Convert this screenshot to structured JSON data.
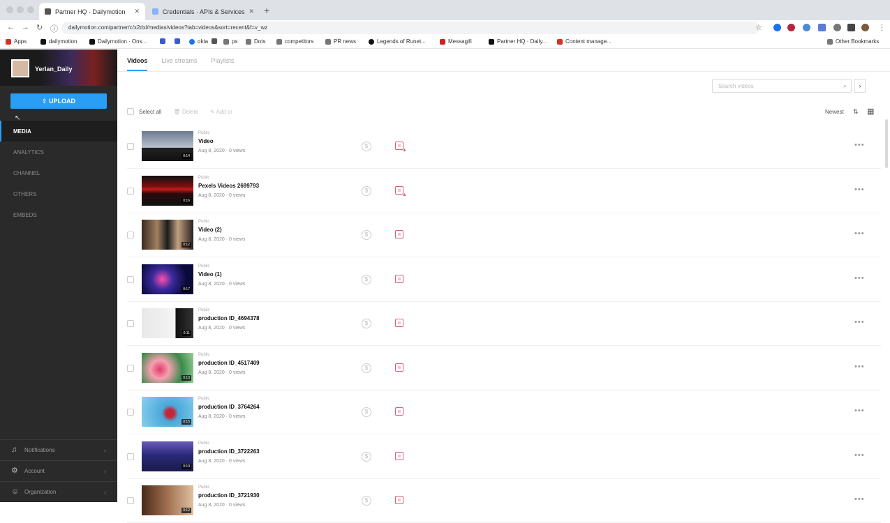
{
  "browser": {
    "tabs": [
      {
        "label": "Partner HQ · Dailymotion",
        "active": true
      },
      {
        "label": "Credentials · APIs & Services",
        "active": false
      }
    ],
    "address": "dailymotion.com/partner/c/x2dxl/medias/videos?tab=videos&sort=recent&f=v_wz",
    "bookmarks": [
      "Apps",
      "dailymotion",
      "Dailymotion · Ons...",
      "",
      "",
      "okta",
      "",
      "ps",
      "Dots",
      "competitors",
      "PR news",
      "Legends of Runet...",
      "Messagifi",
      "Partner HQ · Daily...",
      "Content manage..."
    ],
    "other_bookmarks": "Other Bookmarks"
  },
  "sidebar": {
    "username": "Yerlan_Daily",
    "upload_label": "⇪ UPLOAD",
    "nav": [
      {
        "label": "MEDIA",
        "active": true
      },
      {
        "label": "ANALYTICS",
        "active": false
      },
      {
        "label": "CHANNEL",
        "active": false
      },
      {
        "label": "OTHERS",
        "active": false
      },
      {
        "label": "EMBEDS",
        "active": false
      }
    ],
    "footer": [
      {
        "label": "Notifications",
        "icon": "bell"
      },
      {
        "label": "Account",
        "icon": "gear"
      },
      {
        "label": "Organization",
        "icon": "people"
      }
    ]
  },
  "main": {
    "tabs": [
      {
        "label": "Videos",
        "active": true
      },
      {
        "label": "Live streams",
        "active": false
      },
      {
        "label": "Playlists",
        "active": false
      }
    ],
    "search_placeholder": "Search videos",
    "toolbar": {
      "select_all": "Select all",
      "delete": "Delete",
      "edit": "Add to",
      "sort": "Newest"
    },
    "rows": [
      {
        "visibility": "Public",
        "title": "Video",
        "date": "Aug 8, 2020 · 0 views",
        "duration": "0:14",
        "warn": true,
        "thumb": "sunset"
      },
      {
        "visibility": "Public",
        "title": "Pexels Videos 2699793",
        "date": "Aug 8, 2020 · 0 views",
        "duration": "0:16",
        "warn": true,
        "thumb": "red"
      },
      {
        "visibility": "Public",
        "title": "Video (2)",
        "date": "Aug 8, 2020 · 0 views",
        "duration": "0:12",
        "warn": false,
        "thumb": "band"
      },
      {
        "visibility": "Public",
        "title": "Video (1)",
        "date": "Aug 8, 2020 · 0 views",
        "duration": "0:17",
        "warn": false,
        "thumb": "concert"
      },
      {
        "visibility": "Public",
        "title": "production ID_4694378",
        "date": "Aug 8, 2020 · 0 views",
        "duration": "0:11",
        "warn": false,
        "thumb": "text"
      },
      {
        "visibility": "Public",
        "title": "production ID_4517409",
        "date": "Aug 8, 2020 · 0 views",
        "duration": "0:13",
        "warn": false,
        "thumb": "flowers"
      },
      {
        "visibility": "Public",
        "title": "production ID_3764264",
        "date": "Aug 8, 2020 · 0 views",
        "duration": "0:15",
        "warn": false,
        "thumb": "sea"
      },
      {
        "visibility": "Public",
        "title": "production ID_3722263",
        "date": "Aug 8, 2020 · 0 views",
        "duration": "0:10",
        "warn": false,
        "thumb": "crowd"
      },
      {
        "visibility": "Public",
        "title": "production ID_3721930",
        "date": "Aug 8, 2020 · 0 views",
        "duration": "0:12",
        "warn": false,
        "thumb": "brown"
      }
    ]
  },
  "colors": {
    "accent": "#2a9df4",
    "flag": "#e05a77",
    "sidebar": "#2a2a2a"
  }
}
